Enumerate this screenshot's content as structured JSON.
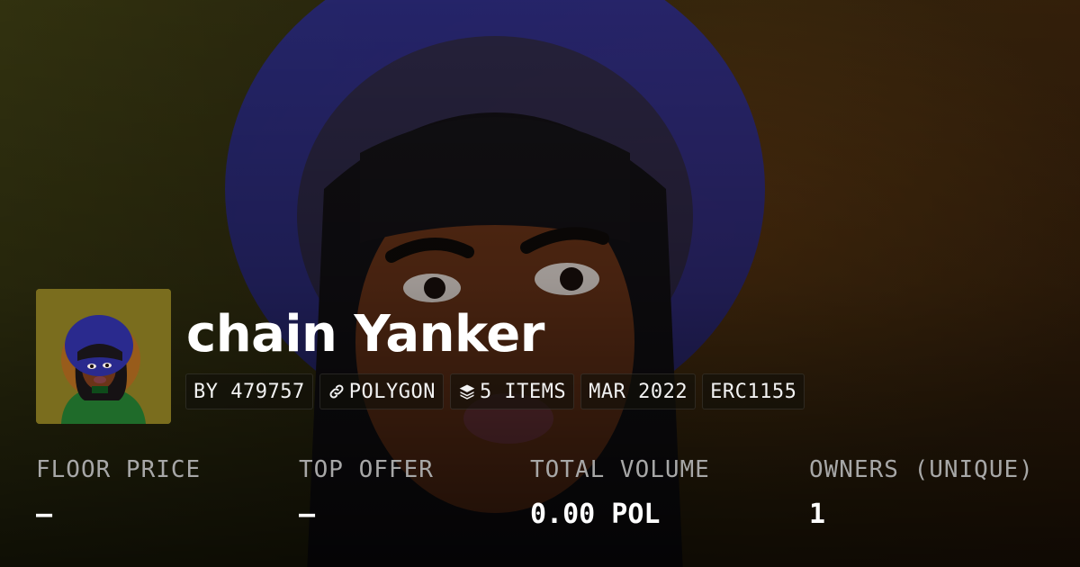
{
  "collection": {
    "title": "chain Yanker",
    "tags": {
      "creator": "BY 479757",
      "chain": "POLYGON",
      "items": "5 ITEMS",
      "date": "MAR 2022",
      "standard": "ERC1155"
    }
  },
  "stats": [
    {
      "label": "FLOOR PRICE",
      "value": "–"
    },
    {
      "label": "TOP OFFER",
      "value": "–"
    },
    {
      "label": "TOTAL VOLUME",
      "value": "0.00 POL"
    },
    {
      "label": "OWNERS (UNIQUE)",
      "value": "1"
    }
  ],
  "icons": {
    "chain": "link-icon",
    "items": "layers-icon"
  },
  "colors": {
    "hat": "#2a2a8e",
    "skin": "#6b3418",
    "avatar_bg": "#7a6d1e",
    "shirt": "#1f6b2a",
    "label": "#a7a7a7",
    "value": "#ffffff"
  }
}
